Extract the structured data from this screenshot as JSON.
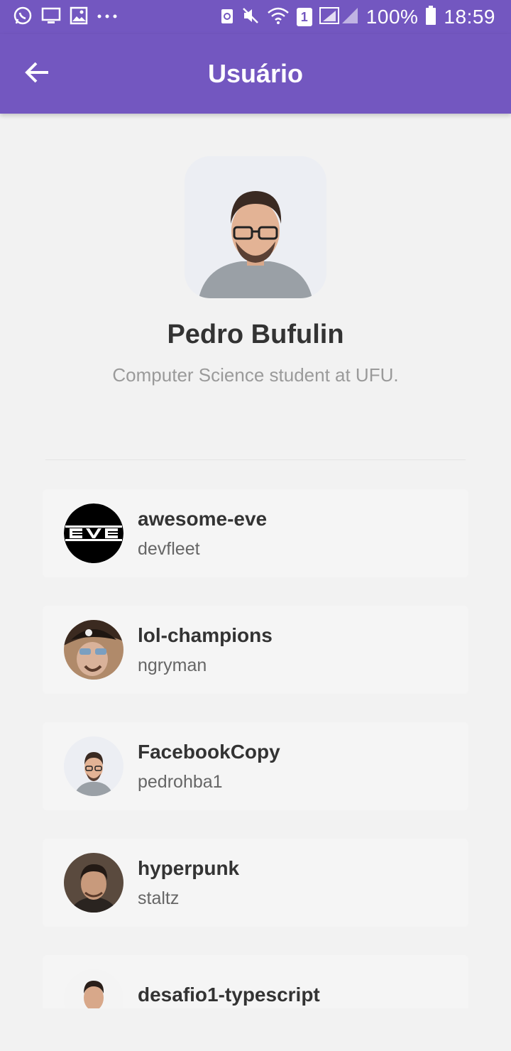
{
  "status_bar": {
    "battery": "100%",
    "time": "18:59",
    "sim_slot": "1",
    "left_icons": [
      "whatsapp-icon",
      "monitor-icon",
      "gallery-icon",
      "more-icon"
    ],
    "right_icons": [
      "recycle-icon",
      "mute-icon",
      "wifi-icon",
      "sim-icon",
      "signal-icon",
      "battery-icon"
    ]
  },
  "app_bar": {
    "title": "Usuário",
    "back_icon": "arrow-left-icon"
  },
  "profile": {
    "name": "Pedro Bufulin",
    "bio": "Computer Science student at UFU."
  },
  "repositories": [
    {
      "title": "awesome-eve",
      "owner": "devfleet",
      "avatar": "eve-logo"
    },
    {
      "title": "lol-champions",
      "owner": "ngryman",
      "avatar": "pirate-avatar"
    },
    {
      "title": "FacebookCopy",
      "owner": "pedrohba1",
      "avatar": "user-photo"
    },
    {
      "title": "hyperpunk",
      "owner": "staltz",
      "avatar": "user-photo"
    },
    {
      "title": "desafio1-typescript",
      "owner": "",
      "avatar": "user-photo"
    }
  ],
  "colors": {
    "primary": "#7357c0",
    "background": "#f2f2f2",
    "card": "#f5f5f5",
    "title_text": "#333333",
    "secondary_text": "#9a9a9a"
  }
}
